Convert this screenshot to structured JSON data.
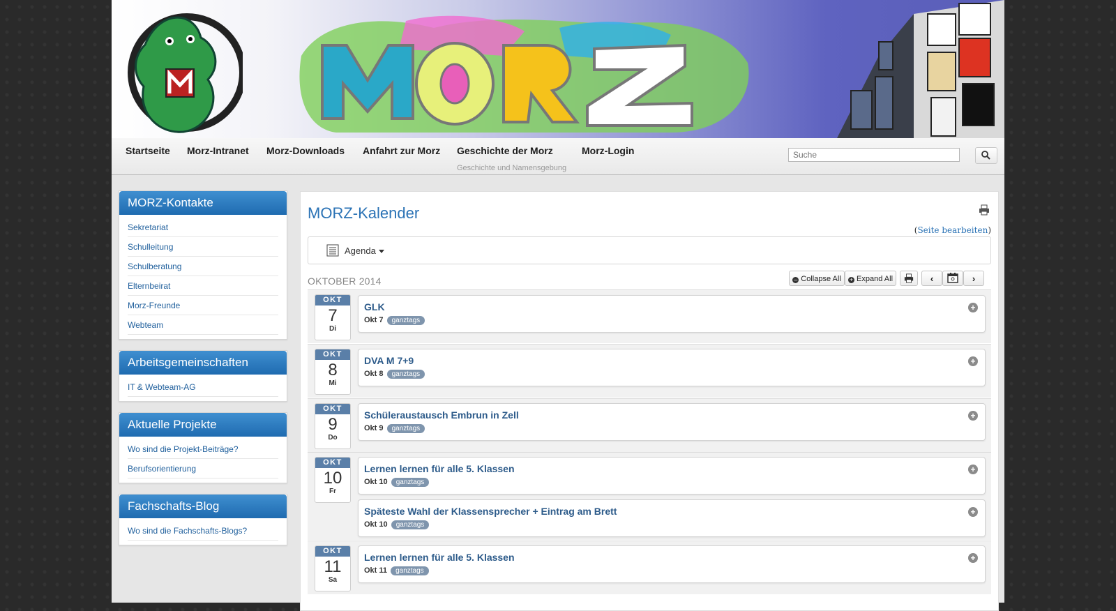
{
  "nav": {
    "items": [
      "Startseite",
      "Morz-Intranet",
      "Morz-Downloads",
      "Anfahrt zur Morz",
      "Geschichte der Morz",
      "Morz-Login"
    ],
    "geschichte_sub": "Geschichte und Namensgebung"
  },
  "search": {
    "placeholder": "Suche"
  },
  "sidebar": [
    {
      "title": "MORZ-Kontakte",
      "items": [
        "Sekretariat",
        "Schulleitung",
        "Schulberatung",
        "Elternbeirat",
        "Morz-Freunde",
        "Webteam"
      ]
    },
    {
      "title": "Arbeitsgemeinschaften",
      "items": [
        "IT & Webteam-AG"
      ]
    },
    {
      "title": "Aktuelle Projekte",
      "items": [
        "Wo sind die Projekt-Beiträge?",
        "Berufsorientierung"
      ]
    },
    {
      "title": "Fachschafts-Blog",
      "items": [
        "Wo sind die Fachschafts-Blogs?"
      ]
    }
  ],
  "main": {
    "title": "MORZ-Kalender",
    "edit_open": "(",
    "edit_link": "Seite bearbeiten",
    "edit_close": ")",
    "view_label": "Agenda",
    "month": "OKTOBER 2014",
    "collapse_all": "Collapse All",
    "expand_all": "Expand All"
  },
  "days": [
    {
      "month": "OKT",
      "num": "7",
      "weekday": "Di",
      "events": [
        {
          "title": "GLK",
          "date": "Okt 7",
          "tag": "ganztags"
        }
      ]
    },
    {
      "month": "OKT",
      "num": "8",
      "weekday": "Mi",
      "events": [
        {
          "title": "DVA M 7+9",
          "date": "Okt 8",
          "tag": "ganztags"
        }
      ]
    },
    {
      "month": "OKT",
      "num": "9",
      "weekday": "Do",
      "events": [
        {
          "title": "Schüleraustausch Embrun in Zell",
          "date": "Okt 9",
          "tag": "ganztags"
        }
      ]
    },
    {
      "month": "OKT",
      "num": "10",
      "weekday": "Fr",
      "events": [
        {
          "title": "Lernen lernen für alle 5. Klassen",
          "date": "Okt 10",
          "tag": "ganztags"
        },
        {
          "title": "Späteste Wahl der Klassensprecher + Eintrag am Brett",
          "date": "Okt 10",
          "tag": "ganztags"
        }
      ]
    },
    {
      "month": "OKT",
      "num": "11",
      "weekday": "Sa",
      "events": [
        {
          "title": "Lernen lernen für alle 5. Klassen",
          "date": "Okt 11",
          "tag": "ganztags"
        }
      ]
    }
  ]
}
